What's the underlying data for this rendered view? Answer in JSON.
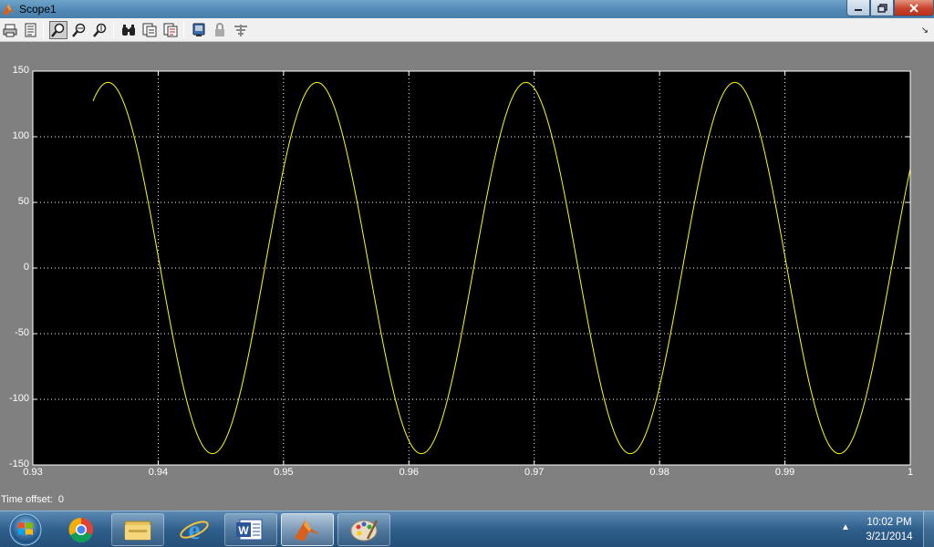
{
  "window": {
    "title": "Scope1"
  },
  "toolbar": {
    "tools": [
      "print-icon",
      "parameters-icon",
      "zoom-icon",
      "zoom-x-icon",
      "zoom-y-icon",
      "autoscale-icon",
      "save-axes-icon",
      "restore-axes-icon",
      "floating-scope-icon",
      "lock-axes-icon",
      "signal-selector-icon"
    ],
    "active_tool": "zoom-icon"
  },
  "chart_data": {
    "type": "line",
    "title": "",
    "xlabel": "",
    "ylabel": "",
    "xlim": [
      0.93,
      1.0
    ],
    "ylim": [
      -150,
      150
    ],
    "x_ticks": [
      "0.93",
      "0.94",
      "0.95",
      "0.96",
      "0.97",
      "0.98",
      "0.99",
      "1"
    ],
    "y_ticks": [
      "150",
      "100",
      "50",
      "0",
      "-50",
      "-100",
      "-150"
    ],
    "grid": true,
    "background": "#000000",
    "series": [
      {
        "color": "#ffff00",
        "amplitude": 141.4,
        "frequency_hz": 60,
        "x_start": 0.9348,
        "x_end": 1.0,
        "points": [
          [
            0.935,
            124
          ],
          [
            0.936,
            141
          ],
          [
            0.938,
            124
          ],
          [
            0.94,
            58
          ],
          [
            0.942,
            -58
          ],
          [
            0.944,
            -141
          ],
          [
            0.946,
            -124
          ],
          [
            0.948,
            -58
          ],
          [
            0.95,
            58
          ],
          [
            0.952,
            141
          ],
          [
            0.954,
            124
          ],
          [
            0.956,
            58
          ],
          [
            0.958,
            -58
          ],
          [
            0.961,
            -141
          ],
          [
            0.963,
            -124
          ],
          [
            0.965,
            -58
          ],
          [
            0.967,
            58
          ],
          [
            0.969,
            141
          ],
          [
            0.971,
            124
          ],
          [
            0.973,
            58
          ],
          [
            0.975,
            -58
          ],
          [
            0.977,
            -141
          ],
          [
            0.979,
            -124
          ],
          [
            0.982,
            -58
          ],
          [
            0.984,
            58
          ],
          [
            0.986,
            141
          ],
          [
            0.988,
            124
          ],
          [
            0.99,
            58
          ],
          [
            0.992,
            -58
          ],
          [
            0.994,
            -141
          ],
          [
            0.996,
            -124
          ],
          [
            0.998,
            -58
          ],
          [
            1.0,
            67
          ]
        ]
      }
    ]
  },
  "status": {
    "time_offset_label": "Time offset:",
    "time_offset_value": "0"
  },
  "taskbar": {
    "apps": [
      "chrome-icon",
      "explorer-icon",
      "internet-explorer-icon",
      "word-icon",
      "matlab-icon",
      "paint-icon"
    ],
    "active_app": "matlab-icon",
    "clock_time": "10:02 PM",
    "clock_date": "3/21/2014"
  }
}
